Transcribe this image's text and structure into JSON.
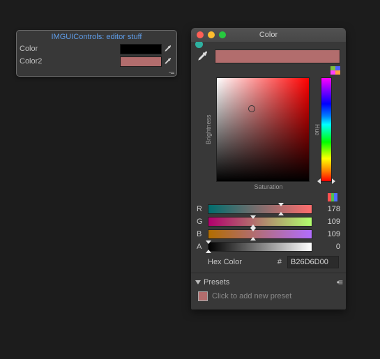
{
  "inspector": {
    "title": "IMGUIControls: editor stuff",
    "fields": [
      {
        "label": "Color",
        "hex": "#000000"
      },
      {
        "label": "Color2",
        "hex": "#B26D6D"
      }
    ]
  },
  "picker": {
    "window_title": "Color",
    "preview_hex": "#B26D6D",
    "labels": {
      "brightness": "Brightness",
      "saturation": "Saturation",
      "hue": "Hue",
      "hex": "Hex Color",
      "hash": "#",
      "presets": "Presets",
      "add_preset": "Click to add new preset"
    },
    "channels": {
      "r": {
        "label": "R",
        "value": 178,
        "pct": 70
      },
      "g": {
        "label": "G",
        "value": 109,
        "pct": 43
      },
      "b": {
        "label": "B",
        "value": 109,
        "pct": 43
      },
      "a": {
        "label": "A",
        "value": 0,
        "pct": 0
      }
    },
    "hex_value": "B26D6D00"
  }
}
